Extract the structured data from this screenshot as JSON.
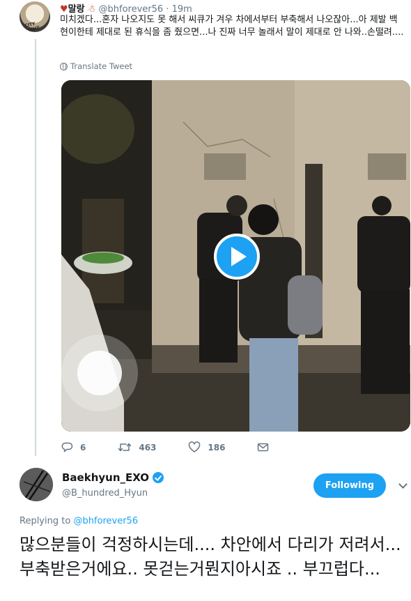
{
  "reply_tweet": {
    "display_name": "말랑",
    "name_emoji_left": "♥",
    "name_emoji_right": "☃",
    "handle": "@bhforever56",
    "separator": "·",
    "time": "19m",
    "text": "미치겠다...혼자 나오지도 못 해서 씨큐가 겨우 차에서부터 부축해서 나오잖아...아 제발 백현이한테 제대로 된 휴식을 좀 줬으면...나 진짜 너무 놀래서 말이 제대로 안 나와..손떨려....",
    "avatar_tag": "CITY LIGHT",
    "translate_label": "Translate Tweet",
    "video": {
      "has_play_button": true
    },
    "actions": {
      "reply_count": "6",
      "retweet_count": "463",
      "like_count": "186"
    }
  },
  "main_tweet": {
    "display_name": "Baekhyun_EXO",
    "verified": true,
    "handle": "@B_hundred_Hyun",
    "follow_label": "Following",
    "replying_prefix": "Replying to",
    "replying_to": "@bhforever56",
    "text": "많으분들이 걱정하시는데.... 차안에서 다리가 저려서... 부축받은거에요.. 못걷는거뭔지아시죠 .. 부끄럽다..."
  },
  "colors": {
    "accent": "#1da1f2",
    "text": "#14171a",
    "muted": "#657786",
    "thread_line": "#cfd9de"
  }
}
